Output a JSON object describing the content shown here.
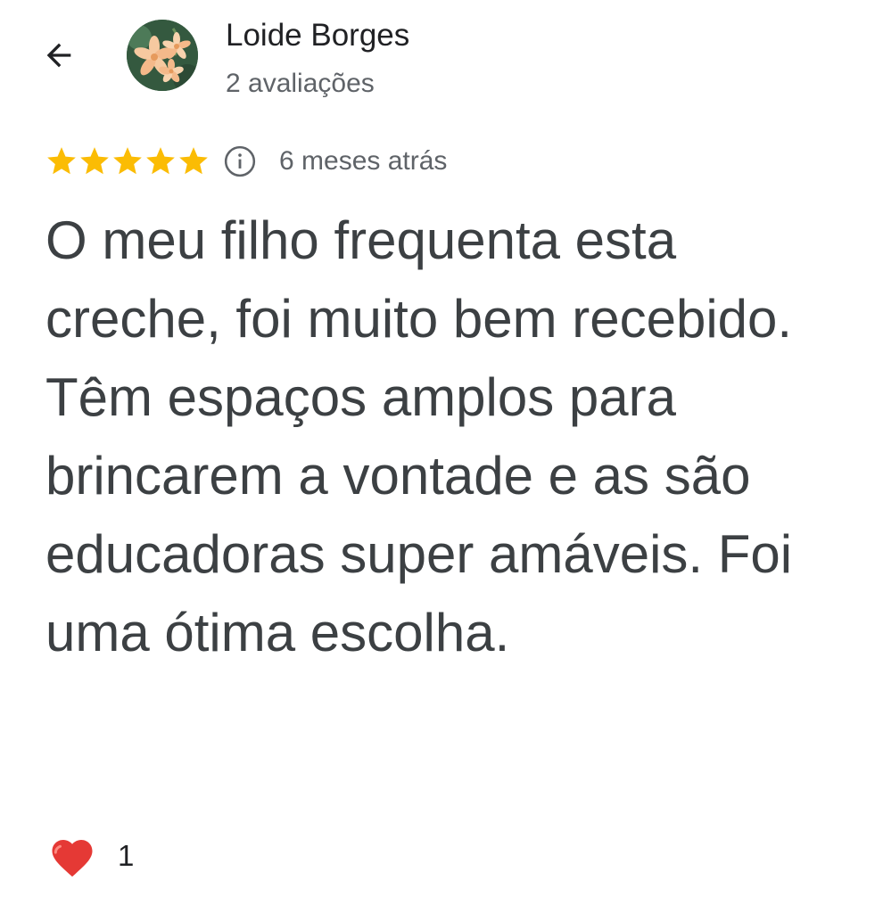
{
  "header": {
    "back_icon": "arrow-left-icon",
    "author_name": "Loide Borges",
    "review_count": "2 avaliações",
    "avatar_icon": "flower-avatar"
  },
  "review": {
    "rating": 5,
    "rating_max": 5,
    "star_color": "#fbbc04",
    "info_icon": "info-icon",
    "date": "6 meses atrás",
    "text": "O meu filho frequenta esta creche, foi muito bem recebido. Têm espaços amplos para brincarem a vontade e as são educadoras super amáveis. Foi uma ótima escolha."
  },
  "reactions": {
    "heart_icon": "heart-icon",
    "heart_color": "#e53935",
    "count": "1"
  }
}
